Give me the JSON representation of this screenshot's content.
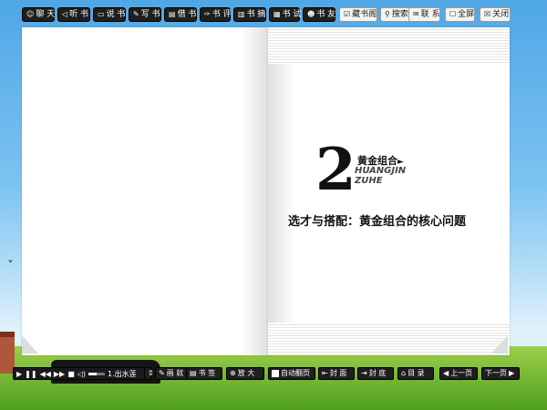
{
  "toolbar": {
    "buttons": [
      {
        "label": "聊 天",
        "icon": "chat-icon"
      },
      {
        "label": "听 书",
        "icon": "listen-icon"
      },
      {
        "label": "说 书",
        "icon": "comment-icon"
      },
      {
        "label": "写 书",
        "icon": "pencil-icon"
      },
      {
        "label": "借 书",
        "icon": "book-icon"
      },
      {
        "label": "书 评",
        "icon": "review-icon"
      },
      {
        "label": "书 摘",
        "icon": "excerpt-icon"
      },
      {
        "label": "书 试",
        "icon": "test-icon"
      },
      {
        "label": "书 友",
        "icon": "friends-icon"
      },
      {
        "label": "藏书阁",
        "icon": "library-icon"
      },
      {
        "label": "搜索",
        "icon": "search-icon"
      },
      {
        "label": "联 系",
        "icon": "mail-icon"
      },
      {
        "label": "全屏",
        "icon": "checkbox-icon"
      },
      {
        "label": "关闭",
        "icon": "close-icon"
      }
    ]
  },
  "book": {
    "chapter_number": "2",
    "chapter_cn": "黄金组合",
    "chapter_en_line1": "HUANGJIN",
    "chapter_en_line2": "ZUHE",
    "chapter_title": "选才与搭配：黄金组合的核心问题"
  },
  "player": {
    "track": "1.出水莲",
    "volume_level": 0.5
  },
  "controls": {
    "catalog_label": "画 就",
    "bookmark_label": "书 签",
    "zoom_label": "放 大",
    "autoflip_label": "自动翻页",
    "cover_label": "封 面",
    "backcover_label": "封 底",
    "toc_label": "目 录",
    "prev_label": "上一页",
    "next_label": "下一页"
  }
}
